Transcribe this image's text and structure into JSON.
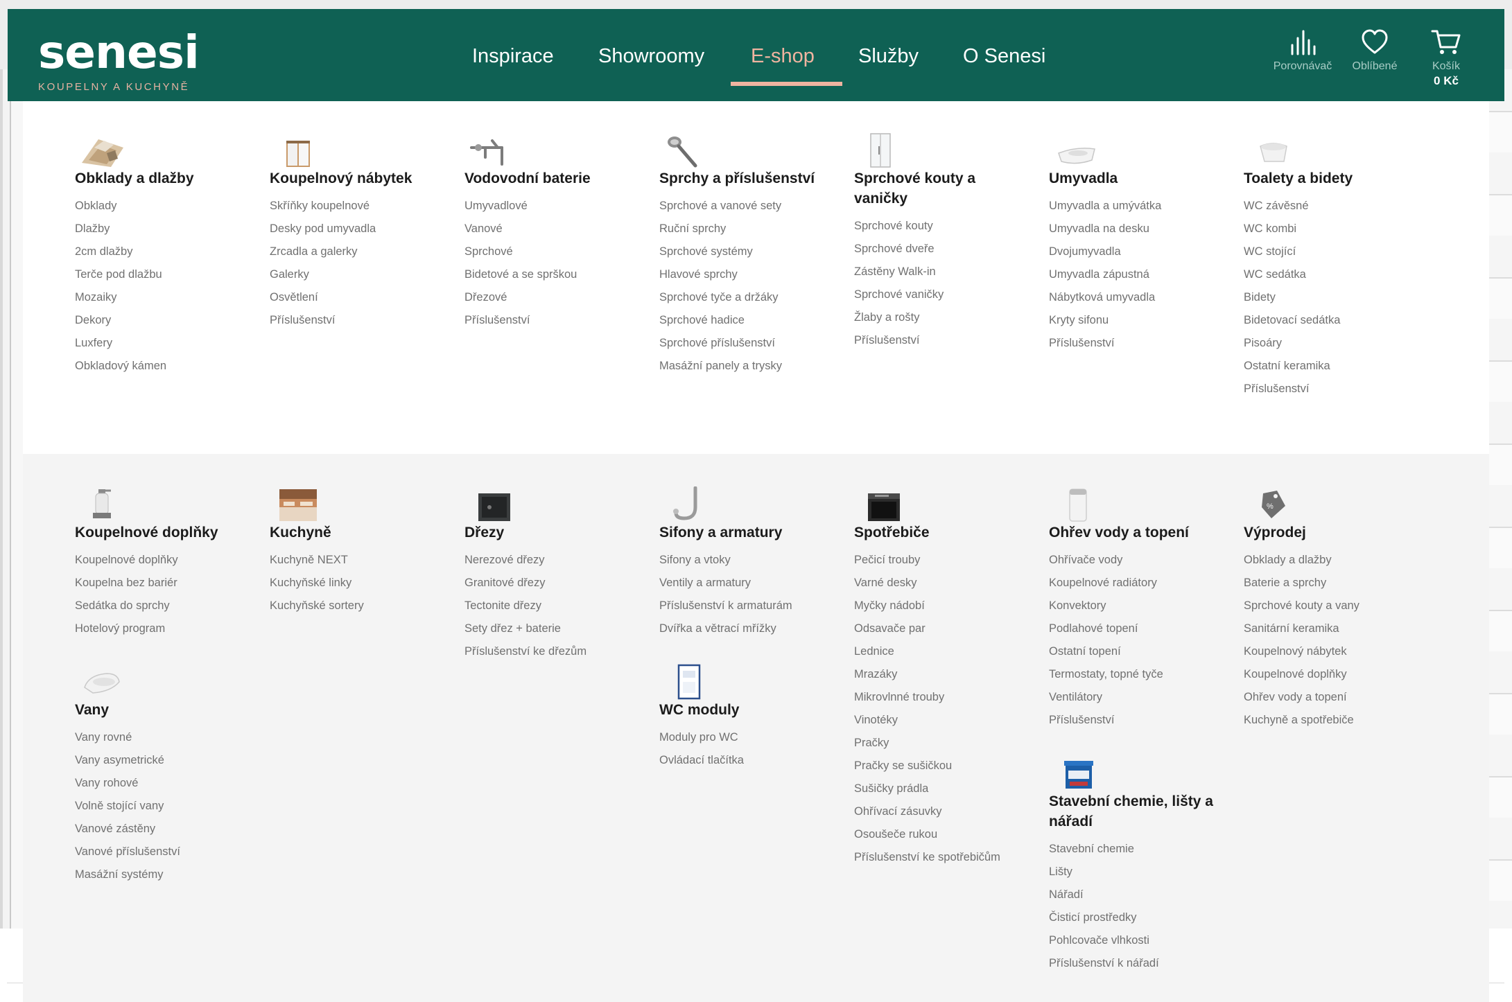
{
  "brand": {
    "name": "senesi",
    "tagline": "KOUPELNY A KUCHYNĚ"
  },
  "nav": {
    "items": [
      {
        "label": "Inspirace"
      },
      {
        "label": "Showroomy"
      },
      {
        "label": "E-shop",
        "active": true
      },
      {
        "label": "Služby"
      },
      {
        "label": "O Senesi"
      }
    ]
  },
  "tools": {
    "compare": {
      "label": "Porovnávač",
      "icon": "bar-chart-icon"
    },
    "favorites": {
      "label": "Oblíbené",
      "icon": "heart-icon"
    },
    "cart": {
      "label": "Košík",
      "value": "0 Kč",
      "icon": "cart-icon"
    }
  },
  "colors": {
    "header": "#0f6154",
    "accent": "#efb4a0",
    "menu_top": "#ffffff",
    "menu_bottom": "#f4f4f4"
  },
  "menu": {
    "top_row": [
      {
        "title": "Obklady a dlažby",
        "icon": "tiles-icon",
        "items": [
          "Obklady",
          "Dlažby",
          "2cm dlažby",
          "Terče pod dlažbu",
          "Mozaiky",
          "Dekory",
          "Luxfery",
          "Obkladový kámen"
        ]
      },
      {
        "title": "Koupelnový nábytek",
        "icon": "cabinet-icon",
        "items": [
          "Skříňky koupelnové",
          "Desky pod umyvadla",
          "Zrcadla a galerky",
          "Galerky",
          "Osvětlení",
          "Příslušenství"
        ]
      },
      {
        "title": "Vodovodní baterie",
        "icon": "faucet-icon",
        "items": [
          "Umyvadlové",
          "Vanové",
          "Sprchové",
          "Bidetové a se sprškou",
          "Dřezové",
          "Příslušenství"
        ]
      },
      {
        "title": "Sprchy a příslušenství",
        "icon": "shower-head-icon",
        "items": [
          "Sprchové a vanové sety",
          "Ruční sprchy",
          "Sprchové systémy",
          "Hlavové sprchy",
          "Sprchové tyče a držáky",
          "Sprchové hadice",
          "Sprchové příslušenství",
          "Masážní panely a trysky"
        ]
      },
      {
        "title": "Sprchové kouty a vaničky",
        "icon": "shower-enclosure-icon",
        "items": [
          "Sprchové kouty",
          "Sprchové dveře",
          "Zástěny Walk-in",
          "Sprchové vaničky",
          "Žlaby a rošty",
          "Příslušenství"
        ]
      },
      {
        "title": "Umyvadla",
        "icon": "washbasin-icon",
        "items": [
          "Umyvadla a umývátka",
          "Umyvadla na desku",
          "Dvojumyvadla",
          "Umyvadla zápustná",
          "Nábytková umyvadla",
          "Kryty sifonu",
          "Příslušenství"
        ]
      },
      {
        "title": "Toalety a bidety",
        "icon": "toilet-icon",
        "items": [
          "WC závěsné",
          "WC kombi",
          "WC stojící",
          "WC sedátka",
          "Bidety",
          "Bidetovací sedátka",
          "Pisoáry",
          "Ostatní keramika",
          "Příslušenství"
        ]
      }
    ],
    "bottom_row": [
      [
        {
          "title": "Koupelnové doplňky",
          "icon": "soap-dispenser-icon",
          "items": [
            "Koupelnové doplňky",
            "Koupelna bez bariér",
            "Sedátka do sprchy",
            "Hotelový program"
          ]
        },
        {
          "title": "Vany",
          "icon": "bathtub-icon",
          "items": [
            "Vany rovné",
            "Vany asymetrické",
            "Vany rohové",
            "Volně stojící vany",
            "Vanové zástěny",
            "Vanové příslušenství",
            "Masážní systémy"
          ]
        }
      ],
      [
        {
          "title": "Kuchyně",
          "icon": "kitchen-icon",
          "items": [
            "Kuchyně NEXT",
            "Kuchyňské linky",
            "Kuchyňské sortery"
          ]
        }
      ],
      [
        {
          "title": "Dřezy",
          "icon": "sink-icon",
          "items": [
            "Nerezové dřezy",
            "Granitové dřezy",
            "Tectonite dřezy",
            "Sety dřez + baterie",
            "Příslušenství ke dřezům"
          ]
        }
      ],
      [
        {
          "title": "Sifony a armatury",
          "icon": "siphon-icon",
          "items": [
            "Sifony a vtoky",
            "Ventily a armatury",
            "Příslušenství k armaturám",
            "Dvířka a větrací mřížky"
          ]
        },
        {
          "title": "WC moduly",
          "icon": "wc-module-icon",
          "items": [
            "Moduly pro WC",
            "Ovládací tlačítka"
          ]
        }
      ],
      [
        {
          "title": "Spotřebiče",
          "icon": "oven-icon",
          "items": [
            "Pečicí trouby",
            "Varné desky",
            "Myčky nádobí",
            "Odsavače par",
            "Lednice",
            "Mrazáky",
            "Mikrovlnné trouby",
            "Vinotéky",
            "Pračky",
            "Pračky se sušičkou",
            "Sušičky prádla",
            "Ohřívací zásuvky",
            "Osoušeče rukou",
            "Příslušenství ke spotřebičům"
          ]
        }
      ],
      [
        {
          "title": "Ohřev vody a topení",
          "icon": "water-heater-icon",
          "items": [
            "Ohřívače vody",
            "Koupelnové radiátory",
            "Konvektory",
            "Podlahové topení",
            "Ostatní topení",
            "Termostaty, topné tyče",
            "Ventilátory",
            "Příslušenství"
          ]
        },
        {
          "title": "Stavební chemie, lišty a nářadí",
          "icon": "paint-bucket-icon",
          "items": [
            "Stavební chemie",
            "Lišty",
            "Nářadí",
            "Čisticí prostředky",
            "Pohlcovače vlhkosti",
            "Příslušenství k nářadí"
          ]
        }
      ],
      [
        {
          "title": "Výprodej",
          "icon": "sale-tag-icon",
          "items": [
            "Obklady a dlažby",
            "Baterie a sprchy",
            "Sprchové kouty a vany",
            "Sanitární keramika",
            "Koupelnový nábytek",
            "Koupelnové doplňky",
            "Ohřev vody a topení",
            "Kuchyně a spotřebiče"
          ]
        }
      ]
    ]
  }
}
